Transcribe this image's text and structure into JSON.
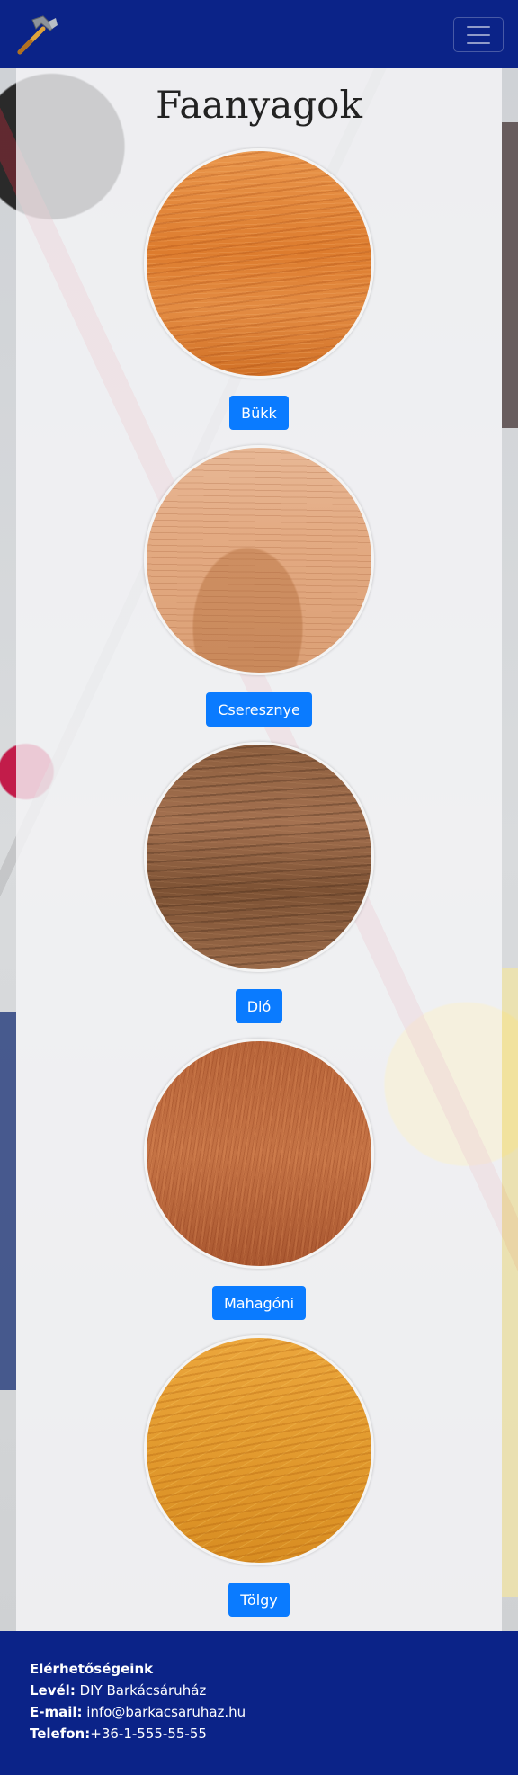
{
  "navbar": {
    "logo_icon": "hammer-icon",
    "menu_icon": "hamburger-menu-icon"
  },
  "main": {
    "title": "Faanyagok",
    "woods": [
      {
        "label": "Bükk"
      },
      {
        "label": "Cseresznye"
      },
      {
        "label": "Dió"
      },
      {
        "label": "Mahagóni"
      },
      {
        "label": "Tölgy"
      }
    ]
  },
  "footer": {
    "heading": "Elérhetőségeink",
    "mail_label": "Levél:",
    "mail_value": " DIY Barkácsáruház",
    "email_label": "E-mail:",
    "email_value": " info@barkacsaruhaz.hu",
    "phone_label": "Telefon:",
    "phone_value": "+36-1-555-55-55"
  },
  "colors": {
    "navbar": "#0b2388",
    "button": "#0a7bff"
  }
}
